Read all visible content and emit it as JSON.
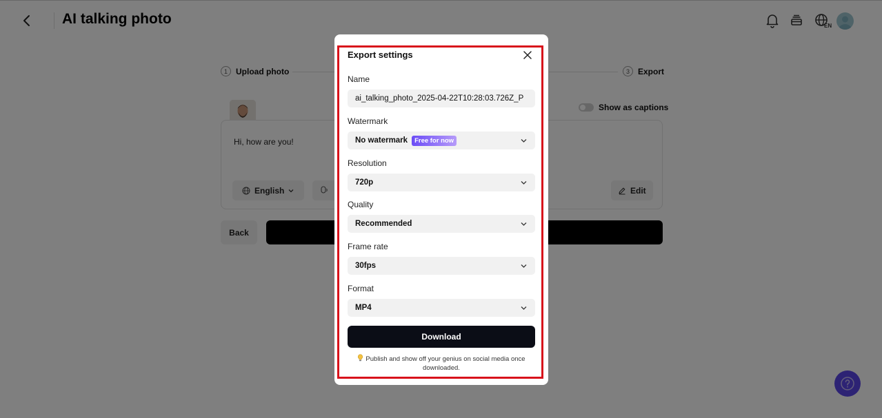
{
  "header": {
    "title": "AI talking photo",
    "language_badge": "EN"
  },
  "steps": [
    {
      "number": "1",
      "label": "Upload photo"
    },
    {
      "number": "3",
      "label": "Export"
    }
  ],
  "editor": {
    "show_captions_label": "Show as captions",
    "script_text": "Hi, how are you!",
    "language_label": "English",
    "edit_label": "Edit"
  },
  "actions": {
    "back_label": "Back"
  },
  "export_modal": {
    "title": "Export settings",
    "name_label": "Name",
    "name_value": "ai_talking_photo_2025-04-22T10:28:03.726Z_P",
    "watermark_label": "Watermark",
    "watermark_value": "No watermark",
    "watermark_badge": "Free for now",
    "resolution_label": "Resolution",
    "resolution_value": "720p",
    "quality_label": "Quality",
    "quality_value": "Recommended",
    "frame_rate_label": "Frame rate",
    "frame_rate_value": "30fps",
    "format_label": "Format",
    "format_value": "MP4",
    "download_label": "Download",
    "footnote": "Publish and show off your genius on social media once downloaded."
  },
  "colors": {
    "accent_purple": "#5b46e8",
    "highlight_red": "#d8121b",
    "primary_dark": "#0b0d16"
  }
}
